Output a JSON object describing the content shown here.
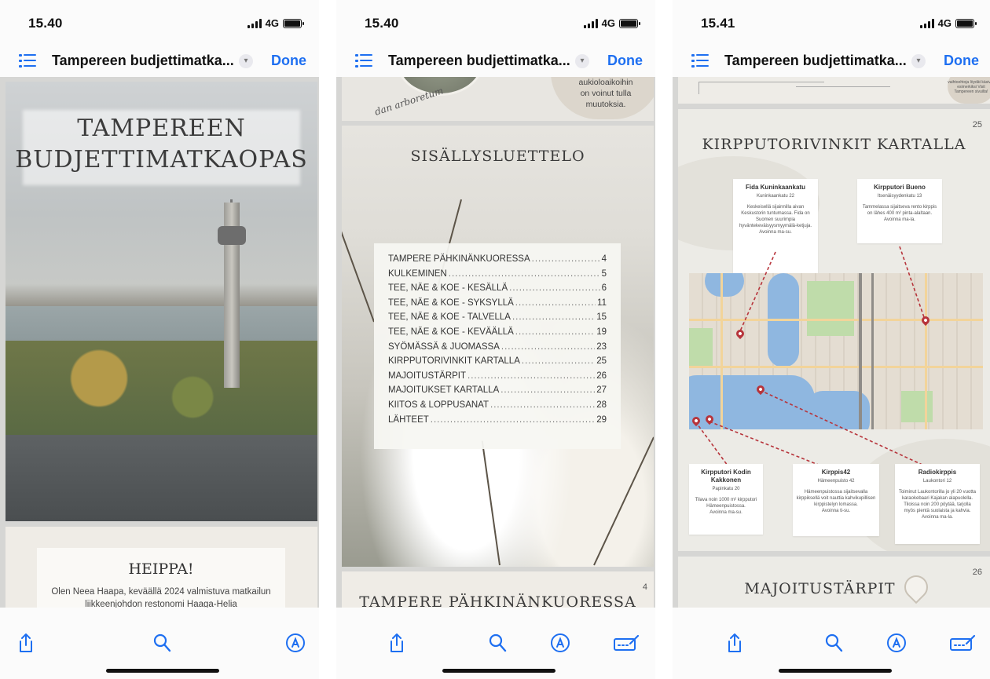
{
  "screens": [
    {
      "status": {
        "time": "15.40",
        "network": "4G"
      },
      "nav": {
        "title": "Tampereen budjettimatka...",
        "done": "Done"
      },
      "pages": {
        "cover_title_line1": "TAMPEREEN",
        "cover_title_line2": "BUDJETTIMATKAOPAS",
        "heippa_title": "HEIPPA!",
        "heippa_text": "Olen Neea Haapa, keväällä 2024 valmistuva matkailun liikkeenjohdon restonomi Haaga-Helia ammattikorkeakoulusta."
      }
    },
    {
      "status": {
        "time": "15.40",
        "network": "4G"
      },
      "nav": {
        "title": "Tampereen budjettimatka...",
        "done": "Done"
      },
      "pages": {
        "top_script": "dan arboretum",
        "top_note": [
          "aukioloaikoihin",
          "on voinut tulla",
          "muutoksia."
        ],
        "toc_title": "SISÄLLYSLUETTELO",
        "toc": [
          {
            "label": "TAMPERE PÄHKINÄNKUORESSA",
            "page": "4"
          },
          {
            "label": "KULKEMINEN",
            "page": "5"
          },
          {
            "label": "TEE, NÄE & KOE - KESÄLLÄ",
            "page": "6"
          },
          {
            "label": "TEE, NÄE & KOE - SYKSYLLÄ",
            "page": "11"
          },
          {
            "label": "TEE, NÄE & KOE - TALVELLA",
            "page": "15"
          },
          {
            "label": "TEE, NÄE & KOE - KEVÄÄLLÄ",
            "page": "19"
          },
          {
            "label": "SYÖMÄSSÄ & JUOMASSA",
            "page": "23"
          },
          {
            "label": "KIRPPUTORIVINKIT KARTALLA",
            "page": "25"
          },
          {
            "label": "MAJOITUSTÄRPIT",
            "page": "26"
          },
          {
            "label": "MAJOITUKSET KARTALLA",
            "page": "27"
          },
          {
            "label": "KIITOS & LOPPUSANAT",
            "page": "28"
          },
          {
            "label": "LÄHTEET",
            "page": "29"
          }
        ],
        "next_page_number": "4",
        "next_page_title": "TAMPERE PÄHKINÄNKUORESSA"
      }
    },
    {
      "status": {
        "time": "15.41",
        "network": "4G"
      },
      "nav": {
        "title": "Tampereen budjettimatka...",
        "done": "Done"
      },
      "pages": {
        "top_note": "vaihtoehtoja löydät käsiväli esimerkiksi Visit Tampereen sivuilta!",
        "page_number": "25",
        "title": "KIRPPUTORIVINKIT KARTALLA",
        "cards": [
          {
            "name": "Fida Kuninkaankatu",
            "address": "Kuninkaankatu 22",
            "desc": "Keskeisellä sijainnilla aivan Keskustorin tuntumassa. Fida on Suomen suurimpia hyväntekeväisyysmyymälä-ketjuja.",
            "hours": "Avoinna ma-su."
          },
          {
            "name": "Kirpputori Bueno",
            "address": "Itsenäisyydenkatu 13",
            "desc": "Tammelassa sijaitseva rento kirppis on lähes 400 m² pinta-alaltaan.",
            "hours": "Avoinna ma-la."
          },
          {
            "name": "Kirpputori Kodin Kakkonen",
            "address": "Papinkatu 20",
            "desc": "Tilava noin 1000 m² kirpputori Hämeenpuistossa.",
            "hours": "Avoinna ma-su."
          },
          {
            "name": "Kirppis42",
            "address": "Hämeenpuisto 42",
            "desc": "Hämeenpuistossa sijaitsevalla kirppiksellä voit nauttia kahvikupillisen kirppistelyn lomassa.",
            "hours": "Avoinna ti-su."
          },
          {
            "name": "Radiokirppis",
            "address": "Laukontori 12",
            "desc": "Toiminut Laukontorilla jo yli 20 vuotta karaokebaari Kajakan alapuolella. Tiloissa noin 200 pöytää, tarjolla myös pientä suolaista ja kahvia.",
            "hours": "Avoinna ma-la."
          }
        ],
        "next_page_number": "26",
        "next_page_title": "MAJOITUSTÄRPIT"
      }
    }
  ],
  "colors": {
    "accent": "#1e6ff1",
    "pin": "#b7343b",
    "route": "#b7343b"
  },
  "icons": [
    "list-icon",
    "chevron-down-icon",
    "share-icon",
    "search-icon",
    "markup-icon",
    "form-icon",
    "map-pin-icon",
    "location-pin-icon"
  ]
}
